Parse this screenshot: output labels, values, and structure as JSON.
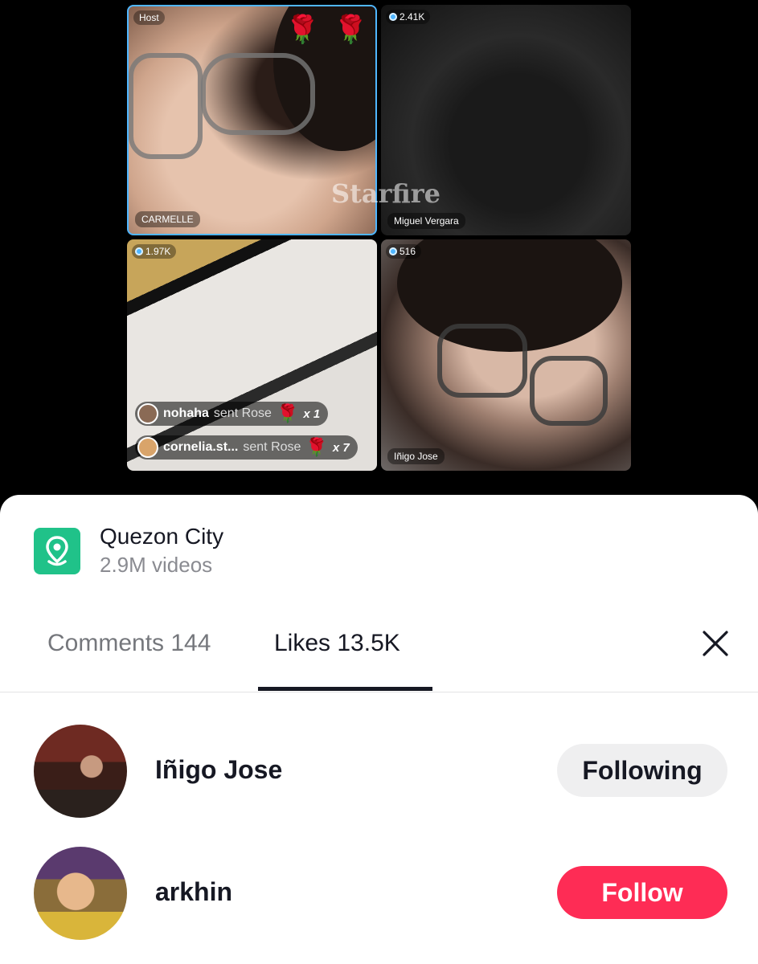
{
  "live": {
    "host_label": "Host",
    "tiles": [
      {
        "name": "CARMELLE",
        "count": ""
      },
      {
        "name": "Miguel Vergara",
        "count": "2.41K"
      },
      {
        "name": "",
        "count": "1.97K"
      },
      {
        "name": "Iñigo Jose",
        "count": "516"
      }
    ],
    "watermark": "Starfire",
    "gifts": [
      {
        "user": "nohaha",
        "action": "sent Rose",
        "multiplier": "x 1"
      },
      {
        "user": "cornelia.st...",
        "action": "sent Rose",
        "multiplier": "x 7"
      }
    ]
  },
  "location": {
    "title": "Quezon City",
    "subtitle": "2.9M videos",
    "icon": "map-pin-icon",
    "accent": "#20c289"
  },
  "tabs": {
    "comments": "Comments 144",
    "likes": "Likes 13.5K",
    "active": "likes"
  },
  "likes_list": [
    {
      "name": "Iñigo Jose",
      "button": "Following",
      "button_state": "following"
    },
    {
      "name": "arkhin",
      "button": "Follow",
      "button_state": "follow"
    }
  ],
  "colors": {
    "follow_button": "#fe2c55",
    "following_button": "#efeff0",
    "live_accent": "#4fb6ff"
  }
}
